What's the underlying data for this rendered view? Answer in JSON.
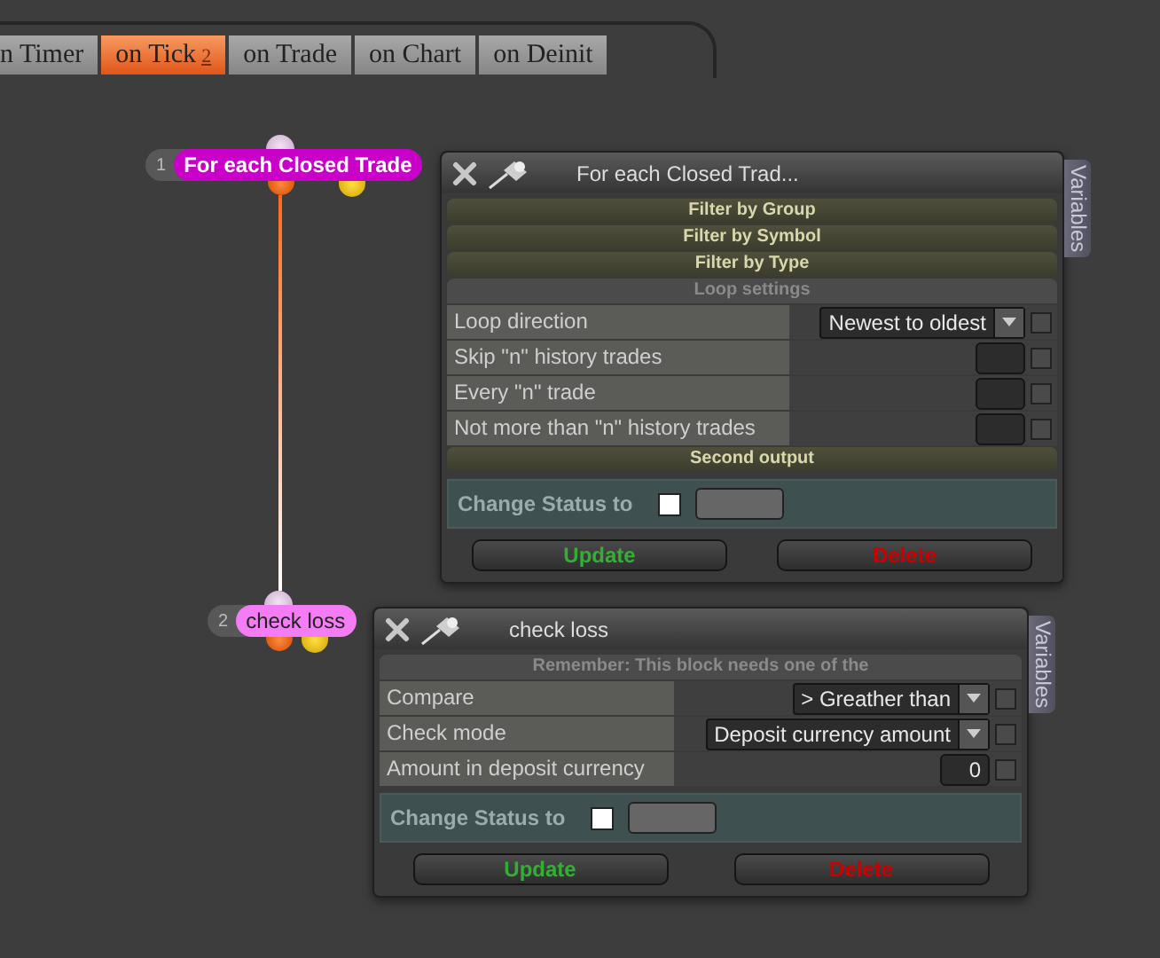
{
  "tabs": [
    {
      "label": "n Timer",
      "selected": false
    },
    {
      "label": "on Tick",
      "selected": true,
      "badge": "2"
    },
    {
      "label": "on Trade",
      "selected": false
    },
    {
      "label": "on Chart",
      "selected": false
    },
    {
      "label": "on Deinit",
      "selected": false
    }
  ],
  "nodes": [
    {
      "number": "1",
      "label": "For each Closed Trade",
      "selected": true
    },
    {
      "number": "2",
      "label": "check loss",
      "selected": false
    }
  ],
  "panels": [
    {
      "title": "For each Closed Trad...",
      "side_tab": "Variables",
      "items": [
        {
          "kind": "section",
          "label": "Filter by Group",
          "expanded": false
        },
        {
          "kind": "section",
          "label": "Filter by Symbol",
          "expanded": false
        },
        {
          "kind": "section",
          "label": "Filter by Type",
          "expanded": false
        },
        {
          "kind": "section",
          "label": "Loop settings",
          "expanded": true
        },
        {
          "kind": "dropdown",
          "label": "Loop direction",
          "value": "Newest to oldest",
          "checked": false
        },
        {
          "kind": "number",
          "label": "Skip \"n\" history trades",
          "checked": false
        },
        {
          "kind": "number",
          "label": "Every \"n\" trade",
          "checked": false
        },
        {
          "kind": "number",
          "label": "Not more than \"n\" history trades",
          "checked": false
        },
        {
          "kind": "section",
          "label": "Second output",
          "expanded": false
        }
      ],
      "status": {
        "label": "Change Status to",
        "checked": false
      },
      "buttons": [
        {
          "label": "Update",
          "kind": "confirm"
        },
        {
          "label": "Delete",
          "kind": "danger"
        }
      ]
    },
    {
      "title": "check loss",
      "side_tab": "Variables",
      "items": [
        {
          "kind": "note",
          "text": "Remember: This block needs one of the"
        },
        {
          "kind": "dropdown",
          "label": "Compare",
          "value": "> Greather than",
          "checked": false
        },
        {
          "kind": "dropdown",
          "label": "Check mode",
          "value": "Deposit currency amount",
          "checked": false
        },
        {
          "kind": "number",
          "label": "Amount in deposit currency",
          "value": "0",
          "checked": false
        }
      ],
      "status": {
        "label": "Change Status to",
        "checked": false
      },
      "buttons": [
        {
          "label": "Update",
          "kind": "confirm"
        },
        {
          "label": "Delete",
          "kind": "danger"
        }
      ]
    }
  ]
}
